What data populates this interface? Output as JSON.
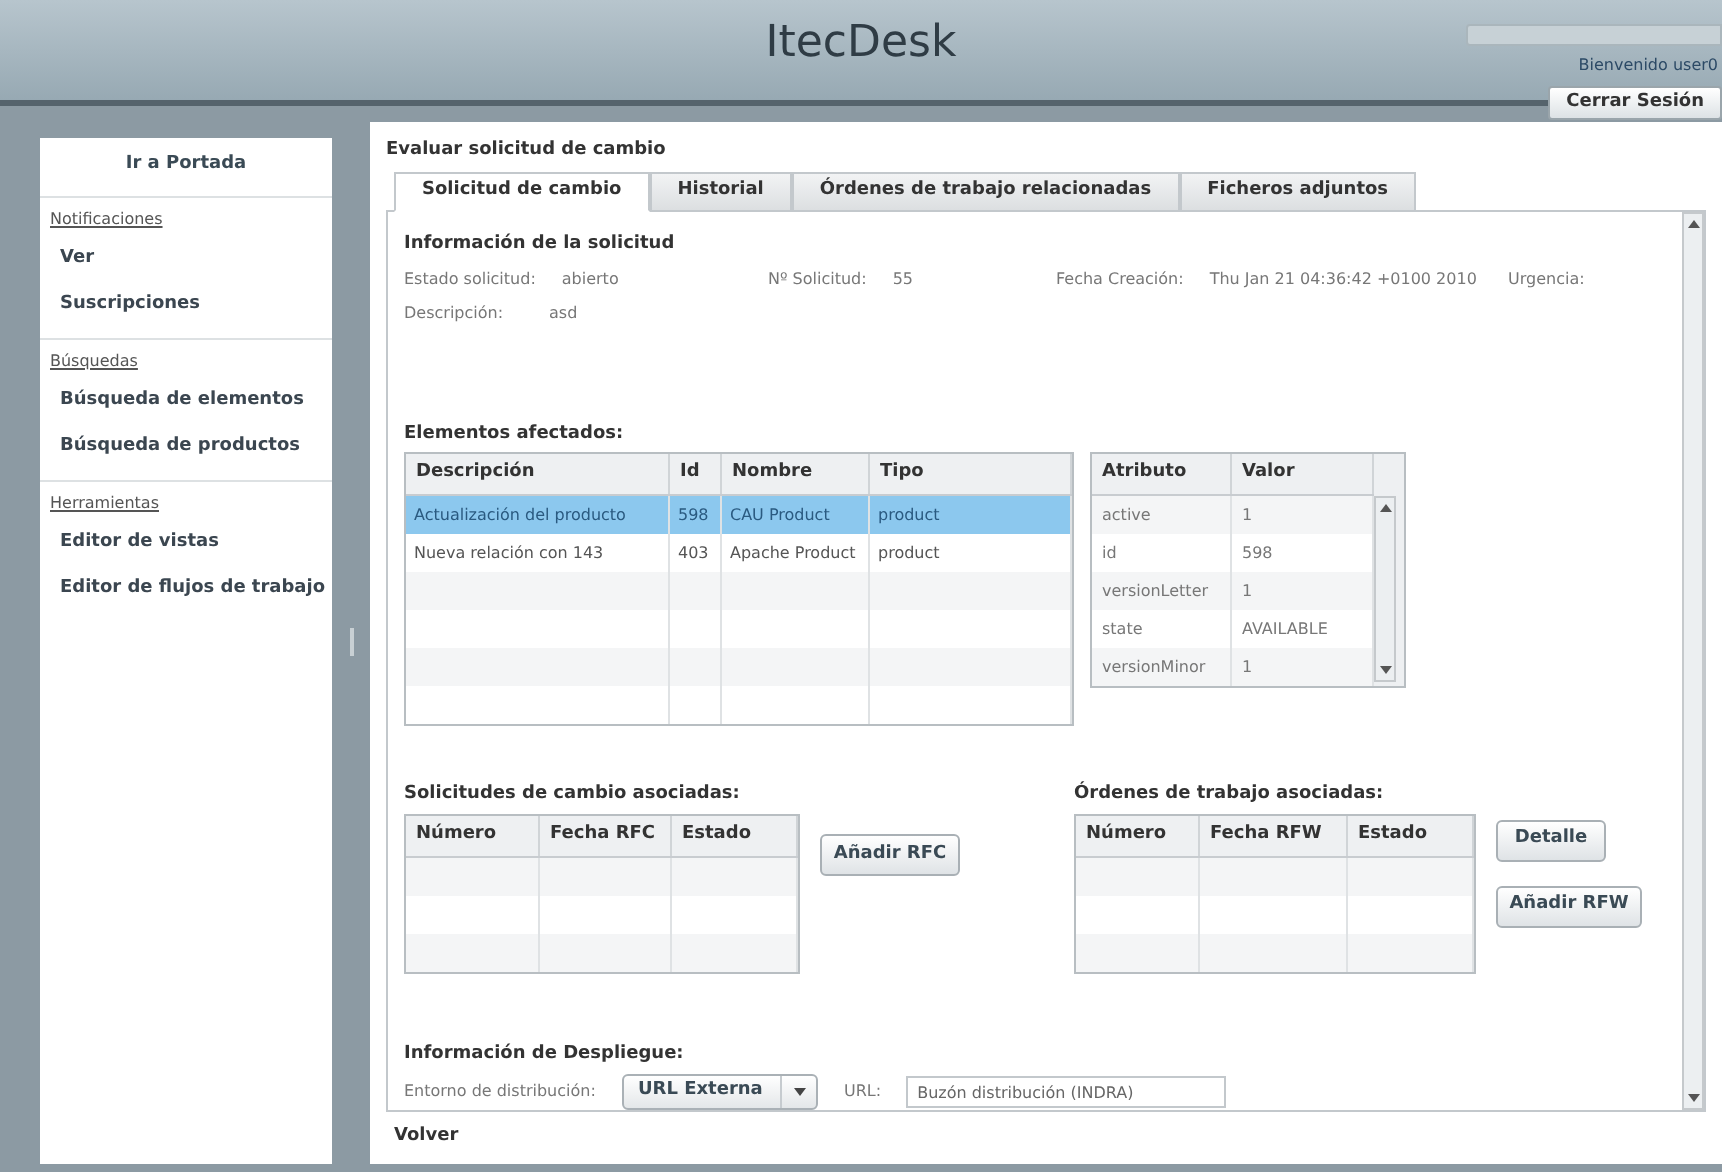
{
  "header": {
    "title": "ItecDesk",
    "welcome": "Bienvenido user0",
    "logout": "Cerrar Sesión"
  },
  "sidebar": {
    "home": "Ir a Portada",
    "sections": [
      {
        "title": "Notificaciones",
        "items": [
          "Ver",
          "Suscripciones"
        ]
      },
      {
        "title": "Búsquedas",
        "items": [
          "Búsqueda de elementos",
          "Búsqueda de productos"
        ]
      },
      {
        "title": "Herramientas",
        "items": [
          "Editor de vistas",
          "Editor de flujos de trabajo"
        ]
      }
    ]
  },
  "page_title": "Evaluar solicitud de cambio",
  "tabs": [
    {
      "label": "Solicitud de cambio",
      "selected": true
    },
    {
      "label": "Historial",
      "selected": false
    },
    {
      "label": "Órdenes de trabajo relacionadas",
      "selected": false
    },
    {
      "label": "Ficheros adjuntos",
      "selected": false
    }
  ],
  "info": {
    "title": "Información de la solicitud",
    "fields": [
      {
        "label": "Estado solicitud:",
        "value": "abierto"
      },
      {
        "label": "Nº Solicitud:",
        "value": "55"
      },
      {
        "label": "Fecha Creación:",
        "value": "Thu Jan 21 04:36:42 +0100 2010"
      },
      {
        "label": "Urgencia:"
      }
    ],
    "description": {
      "label": "Descripción:",
      "value": "asd"
    }
  },
  "affected": {
    "title": "Elementos afectados:",
    "columns": [
      "Descripción",
      "Id",
      "Nombre",
      "Tipo"
    ],
    "rows": [
      {
        "cells": [
          "Actualización del producto",
          "598",
          "CAU Product",
          "product"
        ],
        "selected": true
      },
      {
        "cells": [
          "Nueva relación con 143",
          "403",
          "Apache Product",
          "product"
        ],
        "selected": false
      }
    ]
  },
  "attributes": {
    "columns": [
      "Atributo",
      "Valor"
    ],
    "rows": [
      [
        "active",
        "1"
      ],
      [
        "id",
        "598"
      ],
      [
        "versionLetter",
        "1"
      ],
      [
        "state",
        "AVAILABLE"
      ],
      [
        "versionMinor",
        "1"
      ]
    ]
  },
  "change_requests": {
    "title": "Solicitudes de cambio asociadas:",
    "columns": [
      "Número",
      "Fecha RFC",
      "Estado"
    ],
    "buttons": [
      "Añadir RFC"
    ]
  },
  "work_orders": {
    "title": "Órdenes de trabajo asociadas:",
    "columns": [
      "Número",
      "Fecha RFW",
      "Estado"
    ],
    "buttons": [
      "Detalle",
      "Añadir RFW"
    ]
  },
  "deployment": {
    "title": "Información de Despliegue:",
    "environment_label": "Entorno de distribución:",
    "environment": "URL Externa",
    "url_label": "URL:",
    "url": "Buzón distribución (INDRA)"
  },
  "back": "Volver"
}
